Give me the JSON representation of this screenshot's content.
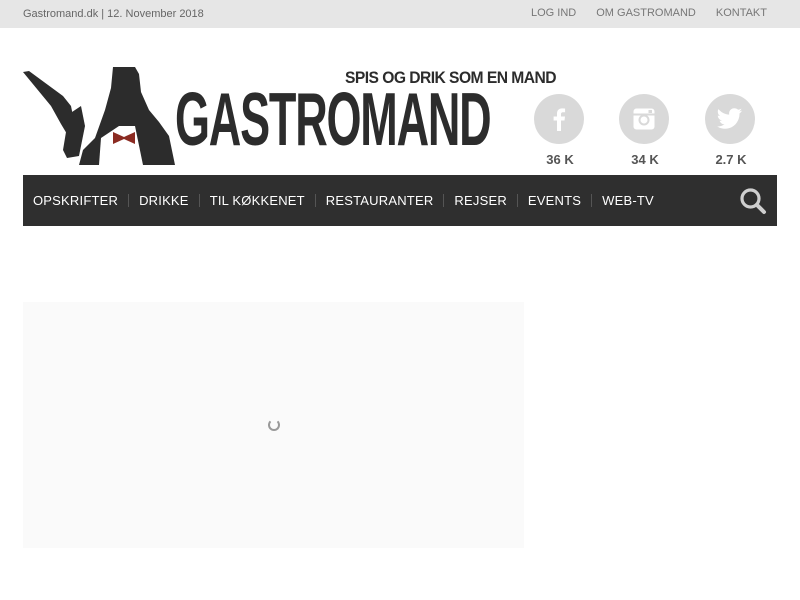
{
  "topbar": {
    "site_date": "Gastromand.dk | 12. November 2018",
    "links": [
      "LOG IND",
      "OM GASTROMAND",
      "KONTAKT"
    ]
  },
  "logo": {
    "tagline": "SPIS OG DRIK SOM EN MAND",
    "wordmark": "GASTROMAND"
  },
  "social": {
    "facebook": {
      "icon": "facebook-icon",
      "count": "36 K"
    },
    "instagram": {
      "icon": "instagram-icon",
      "count": "34 K"
    },
    "twitter": {
      "icon": "twitter-icon",
      "count": "2.7 K"
    }
  },
  "nav": {
    "items": [
      "OPSKRIFTER",
      "DRIKKE",
      "TIL KØKKENET",
      "RESTAURANTER",
      "REJSER",
      "EVENTS",
      "WEB-TV"
    ],
    "search_icon": "search-icon"
  },
  "colors": {
    "topbar_bg": "#e6e6e6",
    "nav_bg": "#2f2f2f",
    "logo": "#2c2c2c",
    "bowtie": "#8b2b22",
    "social_circle": "#d9d9d9"
  }
}
